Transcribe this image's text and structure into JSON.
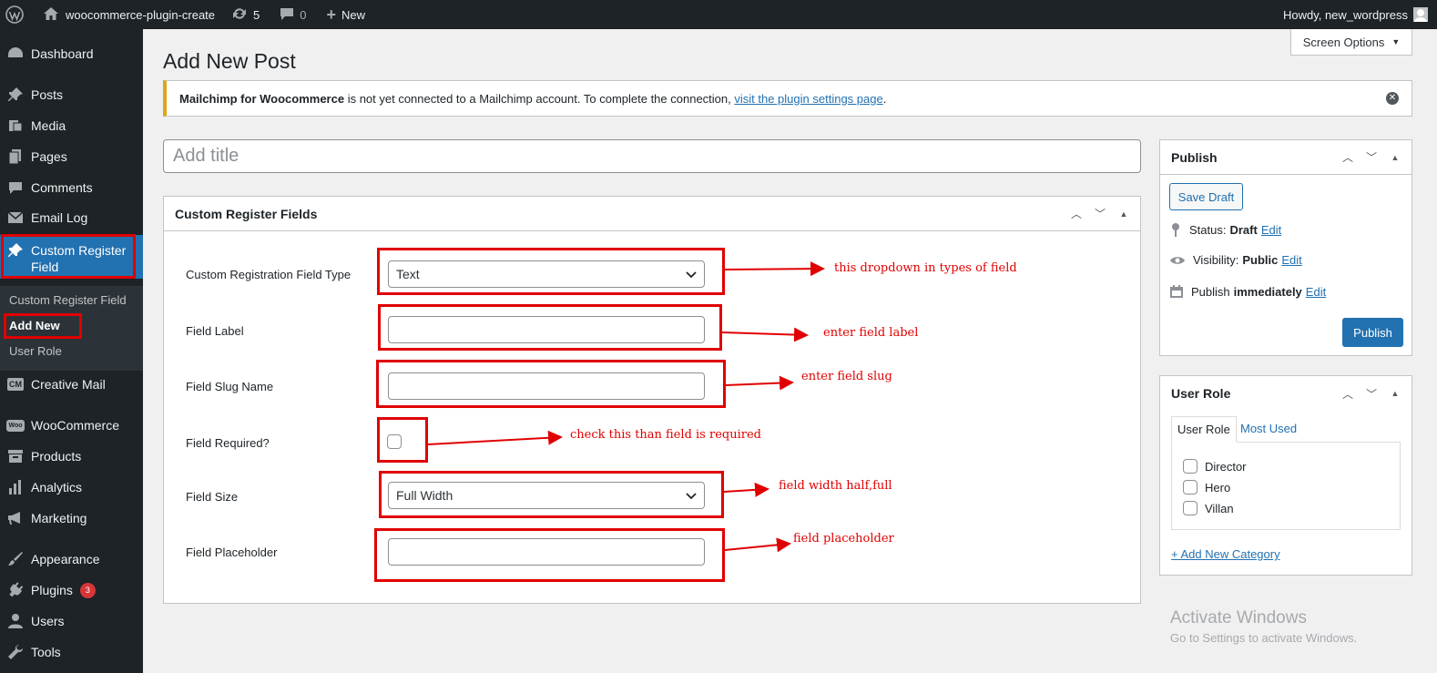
{
  "adminbar": {
    "site_name": "woocommerce-plugin-create",
    "updates_count": "5",
    "comments_count": "0",
    "new_label": "New",
    "howdy": "Howdy, new_wordpress"
  },
  "menu": {
    "dashboard": "Dashboard",
    "posts": "Posts",
    "media": "Media",
    "pages": "Pages",
    "comments": "Comments",
    "email_log": "Email Log",
    "custom_register_field": "Custom Register Field",
    "creative_mail": "Creative Mail",
    "creative_mail_icon": "CM",
    "woocommerce": "WooCommerce",
    "woocommerce_icon": "Woo",
    "products": "Products",
    "analytics": "Analytics",
    "marketing": "Marketing",
    "appearance": "Appearance",
    "plugins": "Plugins",
    "plugins_badge": "3",
    "users": "Users",
    "tools": "Tools",
    "submenu": [
      "Custom Register Field",
      "Add New",
      "User Role"
    ]
  },
  "screen_options": "Screen Options",
  "page_title": "Add New Post",
  "notice": {
    "strong": "Mailchimp for Woocommerce",
    "text": " is not yet connected to a Mailchimp account. To complete the connection, ",
    "link": "visit the plugin settings page",
    "end": "."
  },
  "title_placeholder": "Add title",
  "crf_box": {
    "title": "Custom Register Fields",
    "fields": {
      "type_label": "Custom Registration Field Type",
      "type_value": "Text",
      "label_label": "Field Label",
      "label_value": "",
      "slug_label": "Field Slug Name",
      "slug_value": "",
      "required_label": "Field Required?",
      "size_label": "Field Size",
      "size_value": "Full Width",
      "placeholder_label": "Field Placeholder",
      "placeholder_value": ""
    }
  },
  "annotations": {
    "type": "this dropdown in types of field",
    "label": "enter field label",
    "slug": "enter field slug",
    "required": "check this than field is required",
    "size": "field width half,full",
    "placeholder": "field placeholder"
  },
  "publish_box": {
    "title": "Publish",
    "save_draft": "Save Draft",
    "status_label": "Status:",
    "status_value": "Draft",
    "visibility_label": "Visibility:",
    "visibility_value": "Public",
    "publish_label": "Publish",
    "publish_value": "immediately",
    "edit": "Edit",
    "publish_button": "Publish"
  },
  "user_role_box": {
    "title": "User Role",
    "tab_all": "User Role",
    "tab_most_used": "Most Used",
    "roles": [
      "Director",
      "Hero",
      "Villan"
    ],
    "add_new": "+ Add New Category"
  },
  "watermark": {
    "title": "Activate Windows",
    "subtitle": "Go to Settings to activate Windows."
  },
  "colors": {
    "annotation_red": "#e00000",
    "wp_blue": "#2271b1",
    "admin_dark": "#1d2327"
  }
}
